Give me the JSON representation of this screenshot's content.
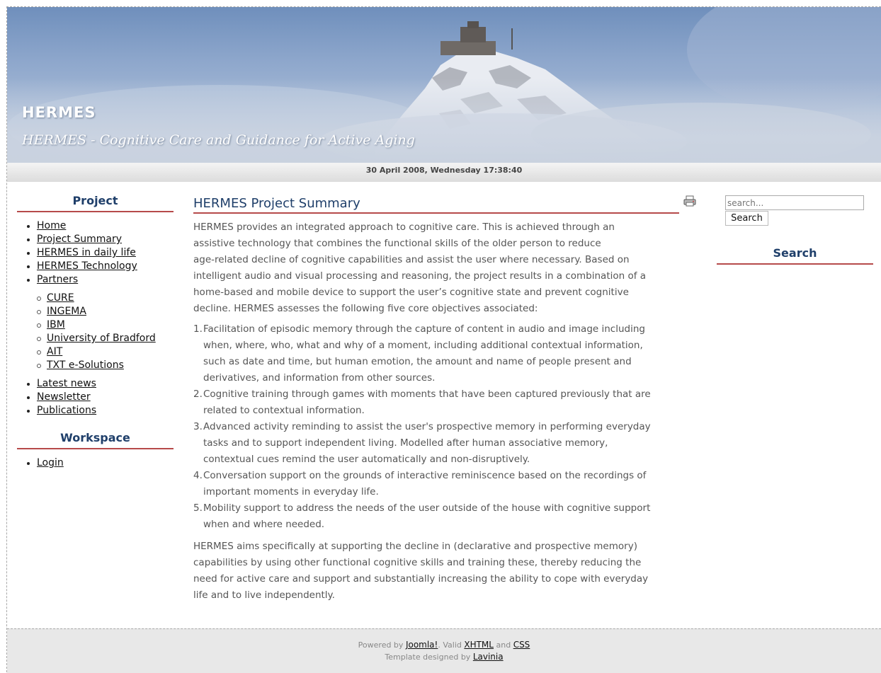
{
  "header": {
    "title": "HERMES",
    "subtitle": "HERMES - Cognitive Care and Guidance for Active Aging"
  },
  "datebar": {
    "text": "30 April 2008, Wednesday 17:38:40"
  },
  "left": {
    "project_title": "Project",
    "menu": {
      "home": "Home",
      "project_summary": "Project Summary",
      "daily_life": "HERMES in daily life",
      "technology": "HERMES Technology",
      "partners": "Partners",
      "partner_items": [
        "CURE",
        "INGEMA",
        "IBM",
        "University of Bradford",
        "AIT",
        "TXT e-Solutions"
      ],
      "latest_news": "Latest news",
      "newsletter": "Newsletter",
      "publications": "Publications"
    },
    "workspace_title": "Workspace",
    "login": "Login"
  },
  "main": {
    "title": "HERMES Project Summary",
    "print_icon": "printer-icon",
    "intro_lines": [
      "HERMES provides an integrated approach to cognitive care. This is achieved through an",
      "assistive technology that combines the functional skills of the older person to reduce",
      "age-related decline of cognitive capabilities and assist the user where necessary. Based on",
      "intelligent audio and visual processing and reasoning, the project results in a combination of a",
      "home-based and mobile device to support the user’s cognitive state and prevent cognitive",
      "decline. HERMES assesses the following five core objectives associated:"
    ],
    "objectives": [
      {
        "num": "1.",
        "lines": [
          "Facilitation of episodic memory through the capture of content in audio and image including",
          "when, where, who, what and why of a moment, including additional contextual information,",
          "such as date and time, but human emotion, the amount and name of people present and",
          "derivatives, and information from other sources."
        ]
      },
      {
        "num": "2.",
        "lines": [
          "Cognitive training through games with moments that have been captured previously that are",
          "related to contextual information."
        ]
      },
      {
        "num": "3.",
        "lines": [
          "Advanced activity reminding to assist the user's prospective memory in performing everyday",
          "tasks and to support independent living. Modelled after human associative memory,",
          "contextual cues remind the user automatically and non-disruptively."
        ]
      },
      {
        "num": "4.",
        "lines": [
          "Conversation support on the grounds of interactive reminiscence based on the recordings of",
          "important moments in everyday life."
        ]
      },
      {
        "num": "5.",
        "lines": [
          "Mobility support to address the needs of the user outside of the house with cognitive support",
          "when and where needed."
        ]
      }
    ],
    "closing_lines": [
      "HERMES aims specifically at supporting the decline in (declarative and prospective memory)",
      "capabilities by using other functional cognitive skills and training these, thereby reducing the",
      "need for active care and support and substantially increasing the ability to cope with everyday",
      "life and to live independently."
    ]
  },
  "right": {
    "search_placeholder": "search...",
    "search_button": "Search",
    "search_title": "Search"
  },
  "footer": {
    "powered_by": "Powered by",
    "joomla": "Joomla!",
    "valid": ". Valid",
    "xhtml": "XHTML",
    "and": "and",
    "css": "CSS",
    "template_by": "Template designed by",
    "lavinia": "Lavinia"
  },
  "colors": {
    "accent_heading": "#1f3f6a",
    "underline_red": "#b64a4a",
    "body_text": "#555555"
  }
}
